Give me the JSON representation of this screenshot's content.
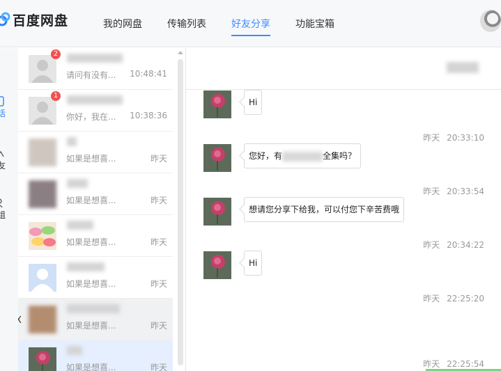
{
  "app": {
    "name": "百度网盘"
  },
  "nav": {
    "items": [
      {
        "label": "我的网盘"
      },
      {
        "label": "传输列表"
      },
      {
        "label": "好友分享"
      },
      {
        "label": "功能宝箱"
      }
    ],
    "active_index": 2
  },
  "rail": {
    "items": [
      {
        "label": "话",
        "icon": "chat-icon"
      },
      {
        "label": "友",
        "icon": "friend-icon"
      },
      {
        "label": "组",
        "icon": "group-icon"
      }
    ]
  },
  "contacts": [
    {
      "badge": "2",
      "preview": "请问有没有...",
      "time": "10:48:41"
    },
    {
      "badge": "1",
      "preview": "你好，我在...",
      "time": "10:38:36"
    },
    {
      "preview": "如果是想喜...",
      "time": "昨天"
    },
    {
      "preview": "如果是想喜...",
      "time": "昨天"
    },
    {
      "preview": "如果是想喜...",
      "time": "昨天"
    },
    {
      "preview": "如果是想喜...",
      "time": "昨天"
    },
    {
      "preview": "如果是想喜...",
      "time": "昨天",
      "close": "X"
    },
    {
      "preview": "如果是想喜...",
      "time": "昨天"
    }
  ],
  "messages": [
    {
      "text": "Hi",
      "stamp": "昨天 20:33:10"
    },
    {
      "text_before": "您好，有",
      "text_after": "全集吗？",
      "stamp": "昨天 20:33:54"
    },
    {
      "text": "想请您分享下给我，可以付您下辛苦费哦",
      "stamp": "昨天 20:34:22"
    },
    {
      "text": "Hi",
      "stamp": "昨天 22:25:20"
    },
    {
      "stamp": "昨天 22:25:54"
    }
  ],
  "colors": {
    "accent": "#3b8cff",
    "badge": "#f0504f"
  }
}
